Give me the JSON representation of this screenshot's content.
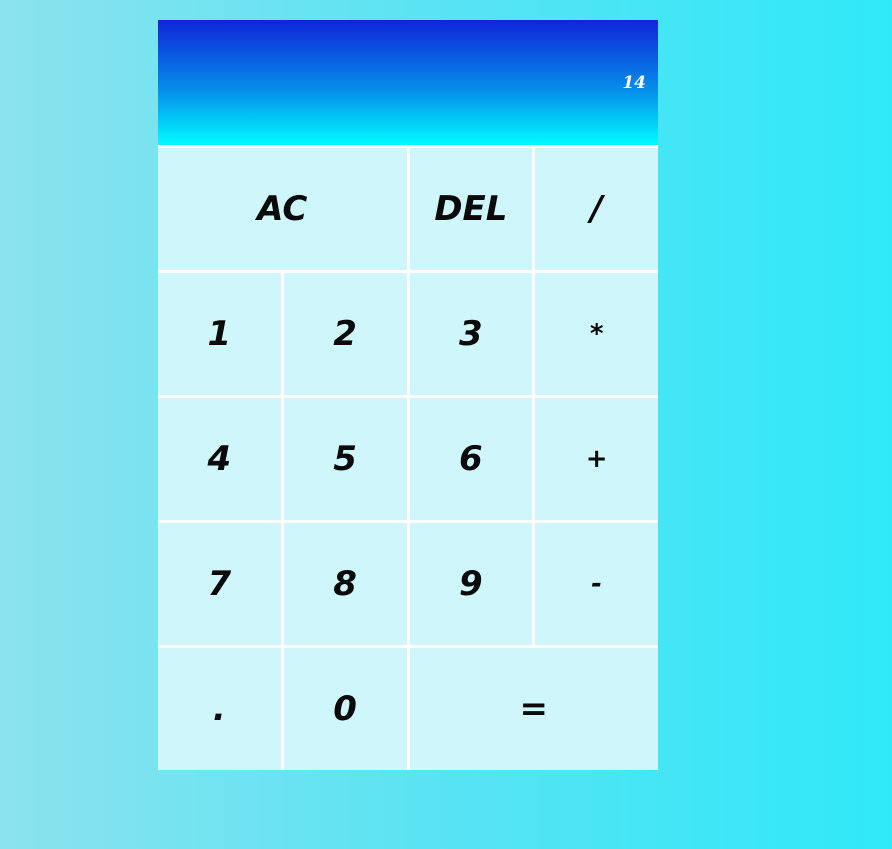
{
  "display": {
    "value": "14"
  },
  "keys": {
    "ac": "AC",
    "del": "DEL",
    "divide": "/",
    "one": "1",
    "two": "2",
    "three": "3",
    "multiply": "*",
    "four": "4",
    "five": "5",
    "six": "6",
    "plus": "+",
    "seven": "7",
    "eight": "8",
    "nine": "9",
    "minus": "-",
    "decimal": ".",
    "zero": "0",
    "equals": "="
  },
  "colors": {
    "display_top": "#0f25d8",
    "display_bottom": "#01fbff",
    "key_bg": "#cff7fb",
    "page_bg_left": "#8be3ee",
    "page_bg_right": "#2fe9f9"
  }
}
